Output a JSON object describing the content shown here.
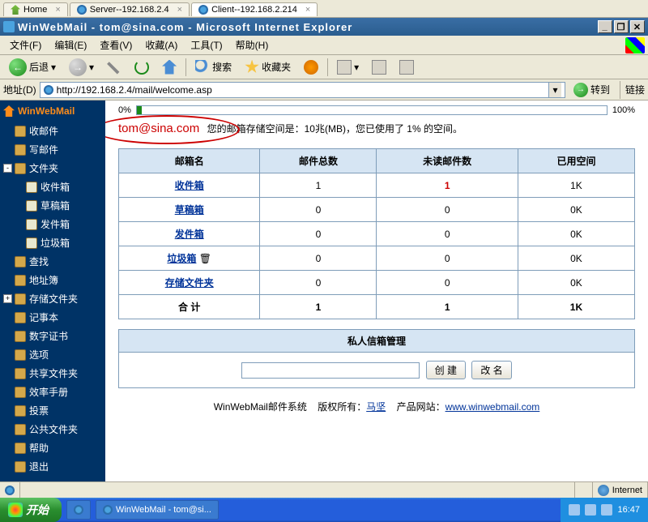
{
  "tabs": [
    {
      "icon": "home",
      "label": "Home",
      "close": true
    },
    {
      "icon": "ie",
      "label": "Server--192.168.2.4",
      "close": true
    },
    {
      "icon": "ie",
      "label": "Client--192.168.2.214",
      "close": true,
      "active": true
    }
  ],
  "ie_title": "WinWebMail - tom@sina.com - Microsoft Internet Explorer",
  "menu": [
    "文件(F)",
    "编辑(E)",
    "查看(V)",
    "收藏(A)",
    "工具(T)",
    "帮助(H)"
  ],
  "toolbar": {
    "back": "后退",
    "search": "搜索",
    "fav": "收藏夹"
  },
  "addr": {
    "label": "地址(D)",
    "url": "http://192.168.2.4/mail/welcome.asp",
    "go": "转到",
    "links": "链接"
  },
  "sidebar": {
    "brand": "WinWebMail",
    "items": [
      {
        "label": "收邮件",
        "lvl": 1
      },
      {
        "label": "写邮件",
        "lvl": 1
      },
      {
        "label": "文件夹",
        "lvl": 1,
        "toggle": "-"
      },
      {
        "label": "收件箱",
        "lvl": 2
      },
      {
        "label": "草稿箱",
        "lvl": 2
      },
      {
        "label": "发件箱",
        "lvl": 2
      },
      {
        "label": "垃圾箱",
        "lvl": 2
      },
      {
        "label": "查找",
        "lvl": 1
      },
      {
        "label": "地址簿",
        "lvl": 1
      },
      {
        "label": "存储文件夹",
        "lvl": 1,
        "toggle": "+"
      },
      {
        "label": "记事本",
        "lvl": 1
      },
      {
        "label": "数字证书",
        "lvl": 1
      },
      {
        "label": "选项",
        "lvl": 1
      },
      {
        "label": "共享文件夹",
        "lvl": 1
      },
      {
        "label": "效率手册",
        "lvl": 1
      },
      {
        "label": "投票",
        "lvl": 1
      },
      {
        "label": "公共文件夹",
        "lvl": 1
      },
      {
        "label": "帮助",
        "lvl": 1
      },
      {
        "label": "退出",
        "lvl": 1
      }
    ]
  },
  "quota": {
    "pct_low": "0%",
    "pct_high": "100%",
    "fill_pct": 1
  },
  "email": {
    "addr": "tom@sina.com",
    "msg": "您的邮箱存储空间是：10兆(MB)，您已使用了 1% 的空间。"
  },
  "table": {
    "headers": [
      "邮箱名",
      "邮件总数",
      "未读邮件数",
      "已用空间"
    ],
    "rows": [
      {
        "name": "收件箱",
        "total": "1",
        "unread": "1",
        "unread_red": true,
        "size": "1K"
      },
      {
        "name": "草稿箱",
        "total": "0",
        "unread": "0",
        "size": "0K"
      },
      {
        "name": "发件箱",
        "total": "0",
        "unread": "0",
        "size": "0K"
      },
      {
        "name": "垃圾箱",
        "total": "0",
        "unread": "0",
        "size": "0K",
        "trash": true
      },
      {
        "name": "存储文件夹",
        "total": "0",
        "unread": "0",
        "size": "0K"
      }
    ],
    "totals": {
      "label": "合 计",
      "total": "1",
      "unread": "1",
      "size": "1K"
    }
  },
  "private": {
    "title": "私人信箱管理",
    "create": "创 建",
    "rename": "改 名"
  },
  "footer": {
    "text1": "WinWebMail邮件系统",
    "text2": "版权所有：",
    "owner": "马坚",
    "text3": "产品网站：",
    "url": "www.winwebmail.com"
  },
  "status": {
    "zone": "Internet"
  },
  "taskbar": {
    "start": "开始",
    "item": "WinWebMail - tom@si...",
    "time": "16:47"
  }
}
